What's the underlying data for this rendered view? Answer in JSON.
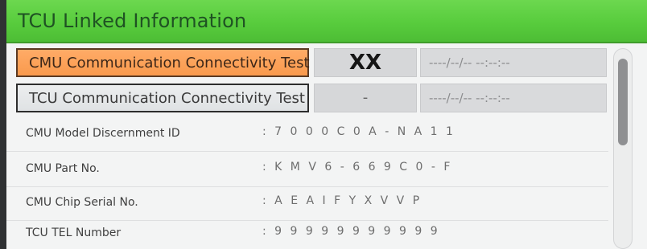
{
  "header": {
    "title": "TCU Linked Information"
  },
  "tests": [
    {
      "button_label": "CMU Communication Connectivity Test",
      "result": "XX",
      "datetime": "----/--/-- --:--:--"
    },
    {
      "button_label": "TCU Communication Connectivity Test",
      "result": "-",
      "datetime": "----/--/-- --:--:--"
    }
  ],
  "info": [
    {
      "label": "CMU Model Discernment ID",
      "value": ": 7 0 0 0 C 0 A - N A 1 1"
    },
    {
      "label": "CMU Part No.",
      "value": ": K M V 6 - 6 6 9 C 0 - F"
    },
    {
      "label": "CMU Chip Serial No.",
      "value": ": A E A I F Y X V V P"
    },
    {
      "label": "TCU TEL Number",
      "value": ": 9 9 9 9 9 9 9 9 9 9 9"
    }
  ],
  "colors": {
    "header_green": "#58cc3d",
    "selected_button": "#f99a4d",
    "unselected_button": "#dfe2e4"
  }
}
